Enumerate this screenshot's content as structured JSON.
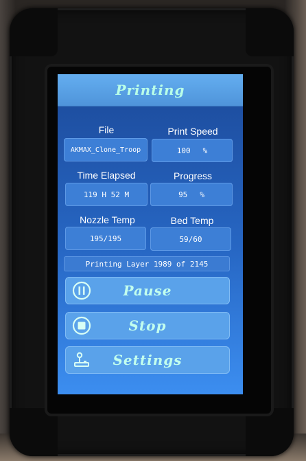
{
  "header": {
    "title": "Printing"
  },
  "file": {
    "label": "File",
    "value": "AKMAX_Clone_Troop"
  },
  "print_speed": {
    "label": "Print Speed",
    "value": "100",
    "unit": "%"
  },
  "time_elapsed": {
    "label": "Time Elapsed",
    "value": "119 H 52 M"
  },
  "progress": {
    "label": "Progress",
    "value": "95",
    "unit": "%"
  },
  "nozzle_temp": {
    "label": "Nozzle Temp",
    "value": "195/195"
  },
  "bed_temp": {
    "label": "Bed Temp",
    "value": "59/60"
  },
  "layer_status": "Printing Layer 1989 of 2145",
  "actions": {
    "pause": {
      "label": "Pause",
      "icon": "pause-circle-icon"
    },
    "stop": {
      "label": "Stop",
      "icon": "stop-circle-icon"
    },
    "settings": {
      "label": "Settings",
      "icon": "joystick-icon"
    }
  },
  "colors": {
    "screen_top": "#1c4a9a",
    "screen_bottom": "#3c8ef0",
    "title_text": "#b9ffe8",
    "button": "#5aa2ea",
    "field": "#3d7fd6"
  }
}
